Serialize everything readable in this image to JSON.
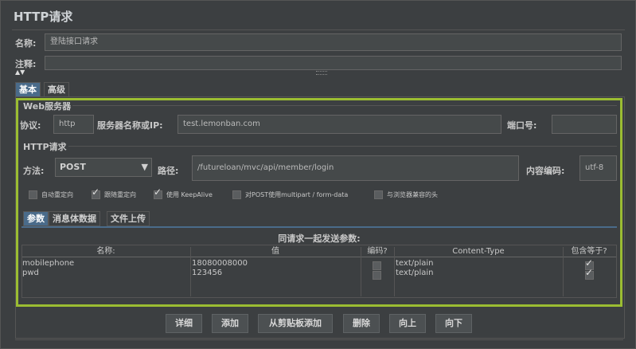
{
  "window": {
    "title": "HTTP请求"
  },
  "name_row": {
    "label": "名称:",
    "value": "登陆接口请求"
  },
  "comment_row": {
    "label": "注释:",
    "value": ""
  },
  "main_tabs": [
    {
      "label": "基本"
    },
    {
      "label": "高级"
    }
  ],
  "web_server": {
    "title": "Web服务器",
    "protocol_label": "协议:",
    "protocol_value": "http",
    "server_label": "服务器名称或IP:",
    "server_value": "test.lemonban.com",
    "port_label": "端口号:",
    "port_value": ""
  },
  "http_request": {
    "title": "HTTP请求",
    "method_label": "方法:",
    "method_value": "POST",
    "path_label": "路径:",
    "path_value": "/futureloan/mvc/api/member/login",
    "encoding_label": "内容编码:",
    "encoding_value": "utf-8",
    "options": [
      {
        "label": "自动重定向",
        "checked": false
      },
      {
        "label": "跟随重定向",
        "checked": true
      },
      {
        "label": "使用 KeepAlive",
        "checked": true
      },
      {
        "label": "对POST使用multipart / form-data",
        "checked": false
      },
      {
        "label": "与浏览器兼容的头",
        "checked": false
      }
    ]
  },
  "param_tabs": [
    {
      "label": "参数"
    },
    {
      "label": "消息体数据"
    },
    {
      "label": "文件上传"
    }
  ],
  "params_table": {
    "caption": "同请求一起发送参数:",
    "headers": {
      "name": "名称:",
      "value": "值",
      "encode": "编码?",
      "content_type": "Content-Type",
      "include_equals": "包含等于?"
    },
    "rows": [
      {
        "name": "mobilephone",
        "value": "18080008000",
        "encode": false,
        "content_type": "text/plain",
        "include_equals": true
      },
      {
        "name": "pwd",
        "value": "123456",
        "encode": false,
        "content_type": "text/plain",
        "include_equals": true
      }
    ]
  },
  "buttons": {
    "detail": "详细",
    "add": "添加",
    "paste": "从剪贴板添加",
    "delete": "删除",
    "up": "向上",
    "down": "向下"
  }
}
